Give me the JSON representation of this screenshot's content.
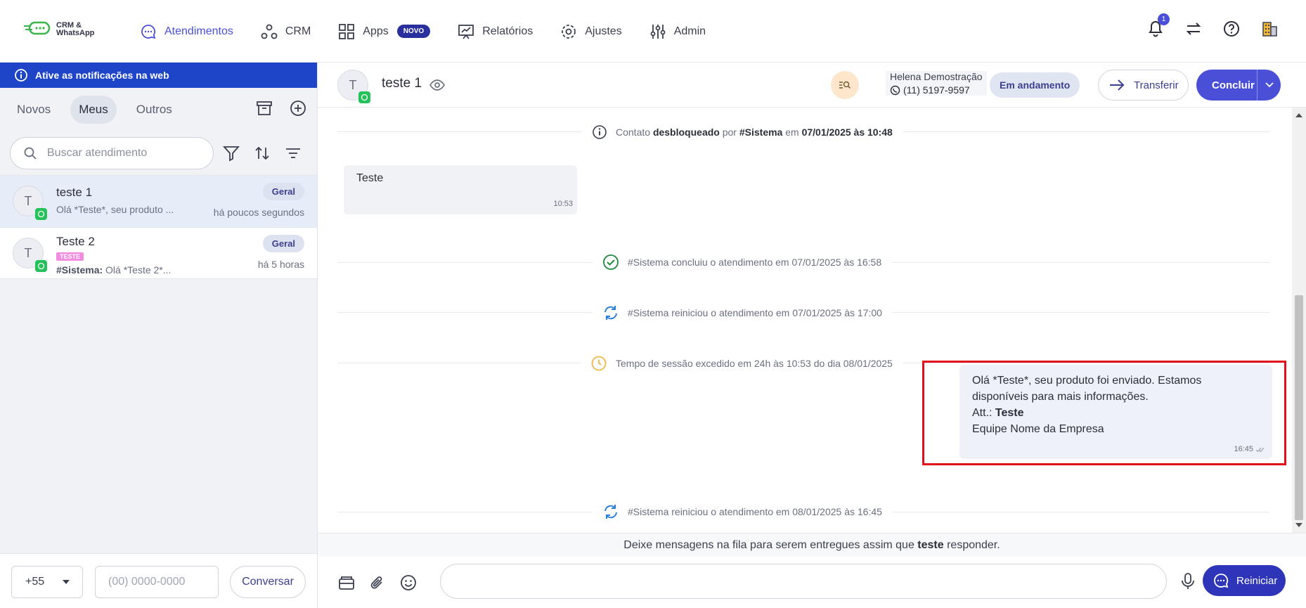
{
  "app": {
    "logo_line1": "CRM &",
    "logo_line2": "WhatsApp"
  },
  "nav": {
    "items": [
      {
        "label": "Atendimentos",
        "icon": "chat-bubble-icon",
        "active": true
      },
      {
        "label": "CRM",
        "icon": "nodes-icon"
      },
      {
        "label": "Apps",
        "icon": "grid-icon",
        "badge": "NOVO"
      },
      {
        "label": "Relatórios",
        "icon": "presentation-chart-icon"
      },
      {
        "label": "Ajustes",
        "icon": "gear-icon"
      },
      {
        "label": "Admin",
        "icon": "sliders-icon"
      }
    ],
    "notification_count": "1"
  },
  "sidebar": {
    "notice": "Ative as notificações na web",
    "tabs": [
      "Novos",
      "Meus",
      "Outros"
    ],
    "active_tab": "Meus",
    "search_placeholder": "Buscar atendimento",
    "conversations": [
      {
        "avatar": "T",
        "name": "teste 1",
        "preview": "Olá *Teste*, seu produto ...",
        "tag": "Geral",
        "time": "há poucos segundos",
        "selected": true
      },
      {
        "avatar": "T",
        "name": "Teste 2",
        "label": "TESTE",
        "preview_prefix": "#Sistema:",
        "preview": "Olá *Teste 2*...",
        "tag": "Geral",
        "time": "há 5 horas"
      }
    ],
    "country_code": "+55",
    "phone_placeholder": "(00) 0000-0000",
    "conversar_label": "Conversar"
  },
  "chat": {
    "avatar": "T",
    "title": "teste 1",
    "agent_name": "Helena Demostração",
    "agent_phone": "(11) 5197-9597",
    "status": "Em andamento",
    "transfer_label": "Transferir",
    "conclude_label": "Concluir",
    "events": [
      {
        "pre": "Contato ",
        "b1": "desbloqueado",
        "mid": " por ",
        "b2": "#Sistema",
        "mid2": " em ",
        "b3": "07/01/2025 às 10:48"
      },
      {
        "text": "#Sistema concluiu o atendimento em 07/01/2025 às 16:58"
      },
      {
        "text": "#Sistema reiniciou o atendimento em 07/01/2025 às 17:00"
      },
      {
        "text": "Tempo de sessão excedido em 24h às 10:53 do dia 08/01/2025"
      },
      {
        "text": "#Sistema reiniciou o atendimento em 08/01/2025 às 16:45"
      }
    ],
    "incoming": {
      "text": "Teste",
      "time": "10:53"
    },
    "outgoing": {
      "line1": "Olá *Teste*, seu produto foi enviado. Estamos disponíveis para mais informações.",
      "att_prefix": "Att.: ",
      "att_name": "Teste",
      "line3": "Equipe Nome da Empresa",
      "time": "16:45"
    },
    "queue_pre": "Deixe mensagens na fila para serem entregues assim que ",
    "queue_name": "teste",
    "queue_post": " responder.",
    "restart_label": "Reiniciar"
  },
  "colors": {
    "accent": "#4a4fd8",
    "notice_bar": "#1e45c8",
    "highlight": "#e0101c",
    "whatsapp": "#25c25a"
  }
}
